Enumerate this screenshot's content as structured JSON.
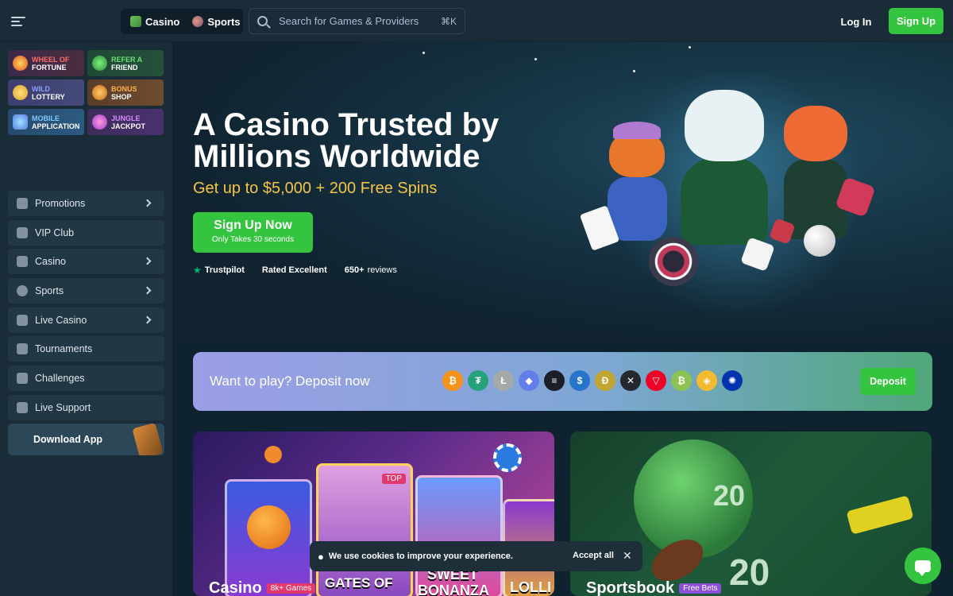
{
  "topbar": {
    "tabs": [
      {
        "label": "Casino",
        "icon": "casino-icon"
      },
      {
        "label": "Sports",
        "icon": "football-icon"
      }
    ],
    "search_placeholder": "Search for Games & Providers",
    "search_shortcut": "⌘K",
    "login_label": "Log In",
    "signup_label": "Sign Up"
  },
  "sidebar": {
    "promos": [
      {
        "line1": "Wheel of",
        "line2": "Fortune",
        "icon": "wheel-icon"
      },
      {
        "line1": "Refer a",
        "line2": "Friend",
        "icon": "megaphone-icon"
      },
      {
        "line1": "Wild",
        "line2": "Lottery",
        "icon": "lottery-icon"
      },
      {
        "line1": "Bonus",
        "line2": "Shop",
        "icon": "shop-icon"
      },
      {
        "line1": "Mobile",
        "line2": "Application",
        "icon": "phone-icon"
      },
      {
        "line1": "Jungle",
        "line2": "Jackpot",
        "icon": "jackpot-icon"
      }
    ],
    "nav": [
      {
        "label": "Promotions",
        "icon": "gift-icon",
        "has_arrow": true
      },
      {
        "label": "VIP Club",
        "icon": "crown-icon",
        "has_arrow": false
      },
      {
        "label": "Casino",
        "icon": "casino-icon",
        "has_arrow": true
      },
      {
        "label": "Sports",
        "icon": "ball-icon",
        "has_arrow": true
      },
      {
        "label": "Live Casino",
        "icon": "dealer-icon",
        "has_arrow": true
      },
      {
        "label": "Tournaments",
        "icon": "trophy-icon",
        "has_arrow": false
      },
      {
        "label": "Challenges",
        "icon": "swords-icon",
        "has_arrow": false
      },
      {
        "label": "Live Support",
        "icon": "support-icon",
        "has_arrow": false
      }
    ],
    "download_label": "Download App"
  },
  "hero": {
    "title": "A Casino Trusted by Millions Worldwide",
    "subtitle": "Get up to $5,000 + 200 Free Spins",
    "cta_main": "Sign Up Now",
    "cta_sub": "Only Takes 30 seconds",
    "trust_brand": "Trustpilot",
    "trust_rating": "Rated Excellent",
    "trust_reviews_count": "650+",
    "trust_reviews_word": "reviews"
  },
  "deposit": {
    "text": "Want to play? Deposit now",
    "button": "Deposit",
    "coins": [
      {
        "name": "bitcoin-icon",
        "glyph": "₿",
        "color": "#f7931a"
      },
      {
        "name": "tether-icon",
        "glyph": "₮",
        "color": "#26a17b"
      },
      {
        "name": "litecoin-icon",
        "glyph": "Ł",
        "color": "#a6a9aa"
      },
      {
        "name": "ethereum-icon",
        "glyph": "◆",
        "color": "#627eea"
      },
      {
        "name": "solana-icon",
        "glyph": "≡",
        "color": "#1b1f2a"
      },
      {
        "name": "usdc-icon",
        "glyph": "$",
        "color": "#2775ca"
      },
      {
        "name": "dogecoin-icon",
        "glyph": "Ð",
        "color": "#c2a633"
      },
      {
        "name": "xrp-icon",
        "glyph": "✕",
        "color": "#23292f"
      },
      {
        "name": "tron-icon",
        "glyph": "▽",
        "color": "#ef0027"
      },
      {
        "name": "bitcoin-cash-icon",
        "glyph": "₿",
        "color": "#8dc351"
      },
      {
        "name": "bnb-icon",
        "glyph": "◈",
        "color": "#f3ba2f"
      },
      {
        "name": "cardano-icon",
        "glyph": "✺",
        "color": "#0033ad"
      }
    ]
  },
  "categories": {
    "casino": {
      "label": "Casino",
      "badge": "8k+ Games",
      "games": [
        "TOP",
        "GATES OF",
        "SWEET",
        "BONANZA",
        "LOLLI"
      ]
    },
    "sports": {
      "label": "Sportsbook",
      "badge": "Free Bets",
      "jersey": "20"
    }
  },
  "cookie": {
    "text": "We use cookies to improve your experience.",
    "accept": "Accept all",
    "close": "✕"
  },
  "colors": {
    "accent": "#35c43f",
    "background": "#1a2c38",
    "gold": "#f5c542"
  }
}
